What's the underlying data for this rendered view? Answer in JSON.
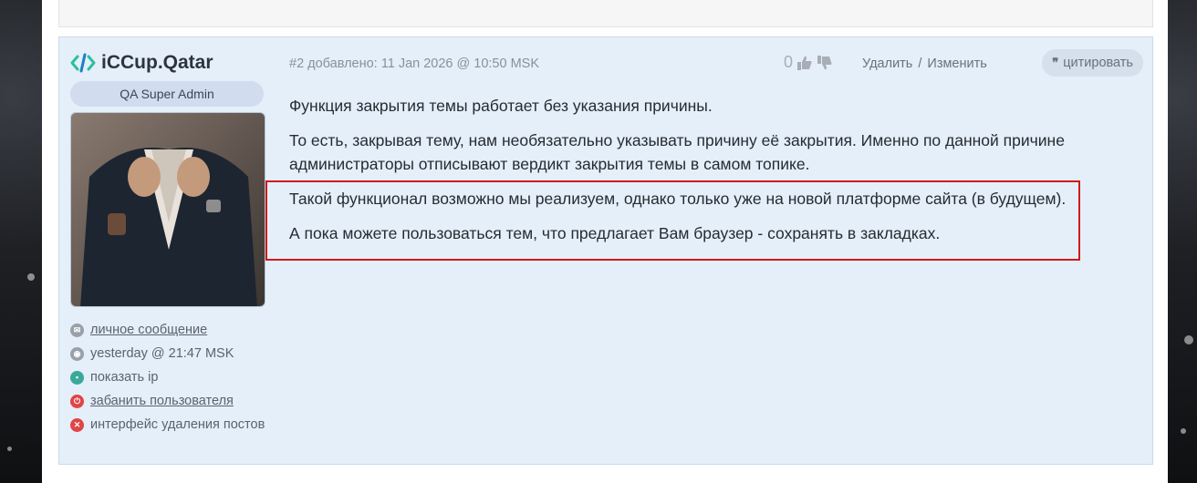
{
  "post": {
    "author": "iCCup.Qatar",
    "role": "QA Super Admin",
    "number_and_date": "#2 добавлено: 11 Jan 2026 @ 10:50 MSK",
    "rating": "0",
    "actions": {
      "delete": "Удалить",
      "separator": "/",
      "edit": "Изменить",
      "quote": "цитировать"
    },
    "sidebar_links": [
      {
        "icon": "envelope-icon",
        "label": "личное сообщение",
        "color": "#9aa0a8"
      },
      {
        "icon": "clock-icon",
        "label": "yesterday @ 21:47 MSK",
        "color": "#9aa0a8"
      },
      {
        "icon": "monitor-icon",
        "label": "показать ip",
        "color": "#3aa89a"
      },
      {
        "icon": "power-icon",
        "label": "забанить пользователя",
        "color": "#e04545"
      },
      {
        "icon": "close-icon",
        "label": "интерфейс удаления постов",
        "color": "#e04545"
      }
    ],
    "paragraphs": [
      "Функция закрытия темы работает без указания причины.",
      "То есть, закрывая тему, нам необязательно указывать причину её закрытия. Именно по данной причине администраторы отписывают вердикт закрытия темы в самом топике.",
      "Такой функционал возможно мы реализуем, однако только уже на новой платформе сайта (в будущем).",
      "А пока можете пользоваться тем, что предлагает Вам браузер - сохранять в закладках."
    ]
  },
  "colors": {
    "post_bg": "#e4eff9",
    "highlight": "#d11a1a",
    "logo_accent": "#2bbfa0"
  }
}
